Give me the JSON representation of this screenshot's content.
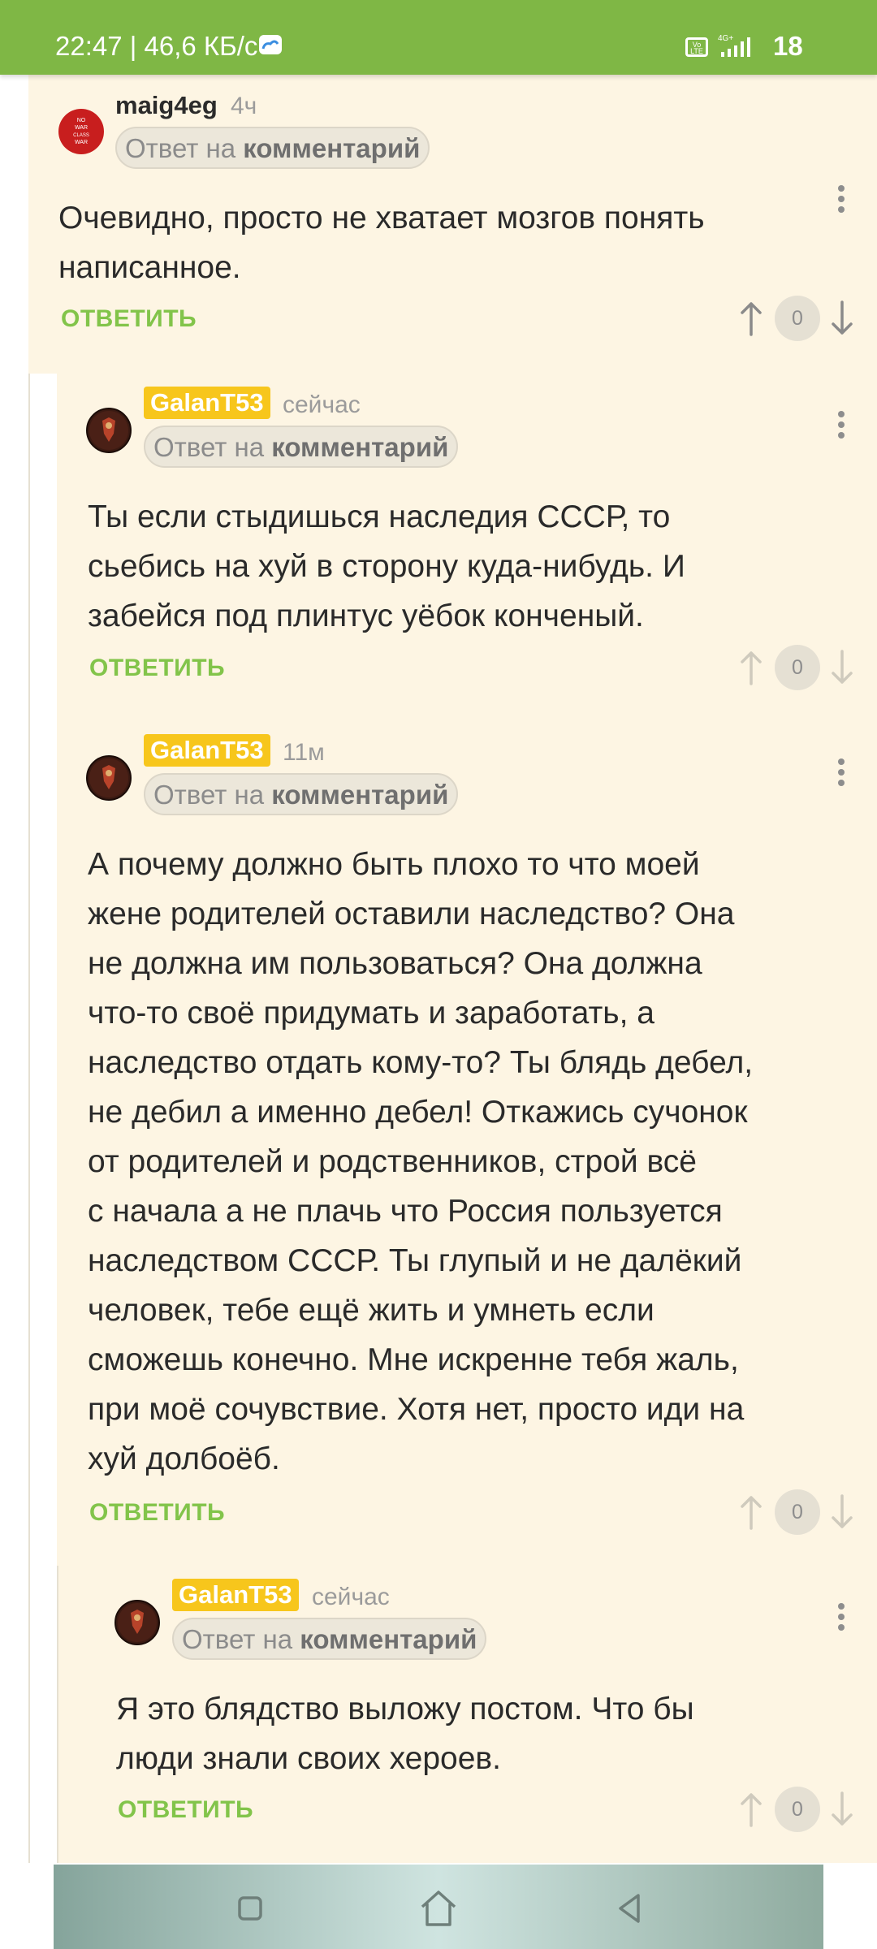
{
  "status_bar": {
    "time_speed": "22:47 | 46,6 КБ/с",
    "volte": "Vo LTE",
    "network": "4G+",
    "battery": "18"
  },
  "comments": [
    {
      "author": "maig4eg",
      "avatar_text": "NO WAR BUT CLASS WAR",
      "time": "4ч",
      "reply_prefix": "Ответ на",
      "reply_target": "комментарий",
      "text": "Очевидно, просто не хватает мозгов понять\nнаписанное.",
      "reply_label": "ОТВЕТИТЬ",
      "votes": "0"
    },
    {
      "author": "GalanT53",
      "time": "сейчас",
      "reply_prefix": "Ответ на",
      "reply_target": "комментарий",
      "text": "Ты если стыдишься наследия СССР, то\nсьебись на хуй в сторону куда-нибудь. И\nзабейся под плинтус уёбок конченый.",
      "reply_label": "ОТВЕТИТЬ",
      "votes": "0"
    },
    {
      "author": "GalanT53",
      "time": "11м",
      "reply_prefix": "Ответ на",
      "reply_target": "комментарий",
      "text": "А почему должно быть плохо то что моей\nжене родителей оставили наследство? Она\nне должна им пользоваться? Она должна\nчто-то своё придумать и заработать, а\nнаследство отдать кому-то? Ты блядь дебел,\nне дебил а именно дебел! Откажись сучонок\nот родителей и родственников, строй всё\nс начала а не плачь что Россия пользуется\nнаследством СССР. Ты глупый и не далёкий\nчеловек, тебе ещё жить и умнеть если\nсможешь конечно. Мне искренне тебя жаль,\nпри моё сочувствие. Хотя нет, просто иди на\nхуй долбоёб.",
      "reply_label": "ОТВЕТИТЬ",
      "votes": "0"
    },
    {
      "author": "GalanT53",
      "time": "сейчас",
      "reply_prefix": "Ответ на",
      "reply_target": "комментарий",
      "text": "Я это блядство выложу постом. Что бы\nлюди знали своих хероев.",
      "reply_label": "ОТВЕТИТЬ",
      "votes": "0"
    }
  ],
  "colors": {
    "status_bar": "#7fb745",
    "thread_bg": "#fdf5e3",
    "accent_green": "#82c44a",
    "badge_yellow": "#f7c61c"
  },
  "icons": [
    "cloud-icon",
    "signal-icon",
    "more-vert-icon",
    "arrow-up-icon",
    "arrow-down-icon",
    "nav-recents-icon",
    "nav-home-icon",
    "nav-back-icon"
  ]
}
